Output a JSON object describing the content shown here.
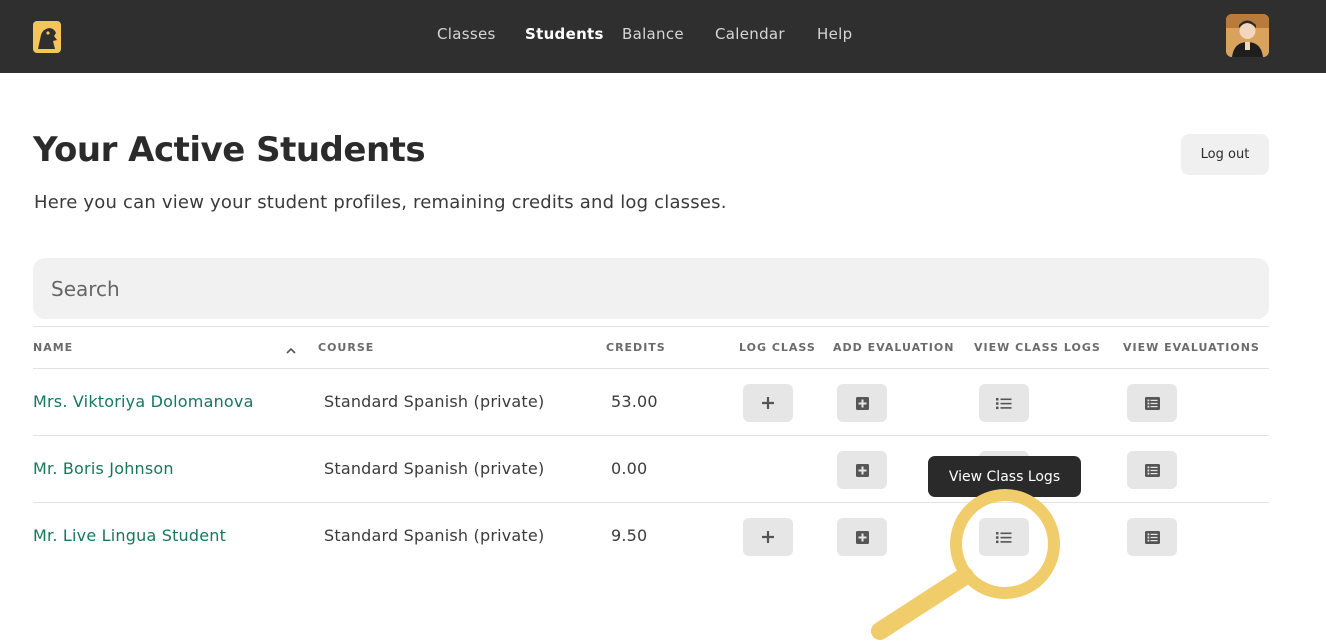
{
  "nav": {
    "items": [
      {
        "label": "Classes",
        "active": false
      },
      {
        "label": "Students",
        "active": true
      },
      {
        "label": "Balance",
        "active": false
      },
      {
        "label": "Calendar",
        "active": false
      },
      {
        "label": "Help",
        "active": false
      }
    ]
  },
  "header": {
    "title": "Your Active Students",
    "subtitle": "Here you can view your student profiles, remaining credits and log classes.",
    "logout_label": "Log out"
  },
  "search": {
    "placeholder": "Search",
    "value": ""
  },
  "table": {
    "columns": [
      "NAME",
      "COURSE",
      "CREDITS",
      "LOG CLASS",
      "ADD EVALUATION",
      "VIEW CLASS LOGS",
      "VIEW EVALUATIONS"
    ],
    "sort": {
      "column": "NAME",
      "direction": "ascending"
    },
    "rows": [
      {
        "name": "Mrs. Viktoriya Dolomanova",
        "course": "Standard Spanish (private)",
        "credits": "53.00",
        "can_log_class": true
      },
      {
        "name": "Mr. Boris Johnson",
        "course": "Standard Spanish (private)",
        "credits": "0.00",
        "can_log_class": false
      },
      {
        "name": "Mr. Live Lingua Student",
        "course": "Standard Spanish (private)",
        "credits": "9.50",
        "can_log_class": true
      }
    ]
  },
  "tooltip": {
    "text": "View Class Logs"
  },
  "colors": {
    "topbar": "#2f2f2f",
    "accent": "#f3c55a",
    "student_link": "#17775a",
    "button_bg": "#e6e6e6",
    "highlight": "#f1cc6a"
  },
  "icons": {
    "logo": "live-lingua-logo",
    "log_class": "plus-icon",
    "add_evaluation": "plus-square-icon",
    "view_class_logs": "list-icon",
    "view_evaluations": "list-alt-icon"
  }
}
